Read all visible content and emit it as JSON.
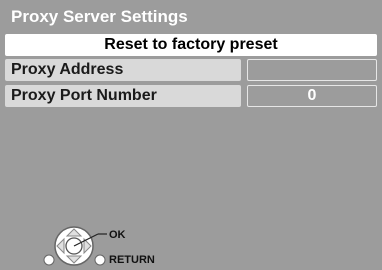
{
  "header": {
    "title": "Proxy Server Settings"
  },
  "reset": {
    "label": "Reset to factory preset"
  },
  "rows": [
    {
      "label": "Proxy Address",
      "value": ""
    },
    {
      "label": "Proxy Port Number",
      "value": "0"
    }
  ],
  "guide": {
    "ok": "OK",
    "return": "RETURN"
  },
  "icons": [
    "dpad-ok-icon",
    "return-button-icon"
  ]
}
